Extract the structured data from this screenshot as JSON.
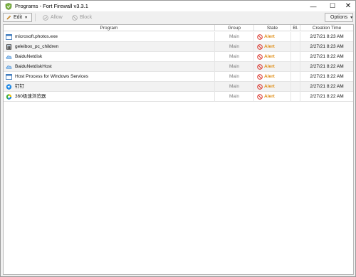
{
  "window": {
    "title": "Programs - Fort Firewall v3.3.1",
    "minimize_glyph": "—",
    "maximize_glyph": "☐",
    "close_glyph": "✕"
  },
  "toolbar": {
    "edit_label": "Edit",
    "allow_label": "Allow",
    "block_label": "Block",
    "options_label": "Options"
  },
  "table": {
    "columns": [
      "Program",
      "Group",
      "State",
      "Bl.",
      "Creation Time"
    ],
    "rows": [
      {
        "program": "microsoft.photos.exe",
        "group": "Main",
        "state": "Alert",
        "bl": "",
        "time": "2/27/21 8:23 AM",
        "icon": "app-window-icon"
      },
      {
        "program": "geleibox_pc_children",
        "group": "Main",
        "state": "Alert",
        "bl": "",
        "time": "2/27/21 8:23 AM",
        "icon": "calculator-icon"
      },
      {
        "program": "BaiduNetdisk",
        "group": "Main",
        "state": "Alert",
        "bl": "",
        "time": "2/27/21 8:22 AM",
        "icon": "baidu-cloud-icon"
      },
      {
        "program": "BaiduNetdiskHost",
        "group": "Main",
        "state": "Alert",
        "bl": "",
        "time": "2/27/21 8:22 AM",
        "icon": "baidu-cloud-icon"
      },
      {
        "program": "Host Process for Windows Services",
        "group": "Main",
        "state": "Alert",
        "bl": "",
        "time": "2/27/21 8:22 AM",
        "icon": "app-window-icon"
      },
      {
        "program": "钉钉",
        "group": "Main",
        "state": "Alert",
        "bl": "",
        "time": "2/27/21 8:22 AM",
        "icon": "dingtalk-icon"
      },
      {
        "program": "360极速浏览器",
        "group": "Main",
        "state": "Alert",
        "bl": "",
        "time": "2/27/21 8:22 AM",
        "icon": "browser-360-icon"
      }
    ]
  },
  "colors": {
    "alert": "#e0901a",
    "alert_icon": "#d9342b",
    "alt_row": "#f2f2f2"
  }
}
